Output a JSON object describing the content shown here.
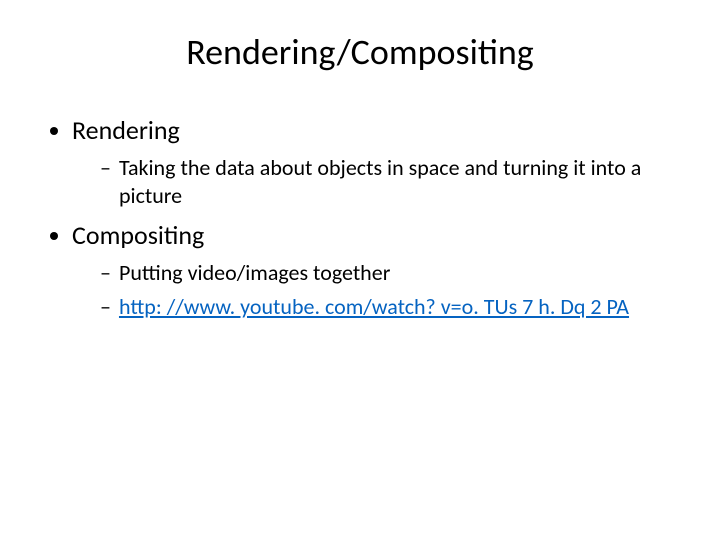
{
  "title": "Rendering/Compositing",
  "items": [
    {
      "label": "Rendering",
      "sub": [
        "Taking the data about objects in space and turning it into a picture"
      ]
    },
    {
      "label": "Compositing",
      "sub": [
        "Putting video/images together"
      ],
      "link": "http: //www. youtube. com/watch? v=o. TUs 7 h. Dq 2 PA"
    }
  ]
}
